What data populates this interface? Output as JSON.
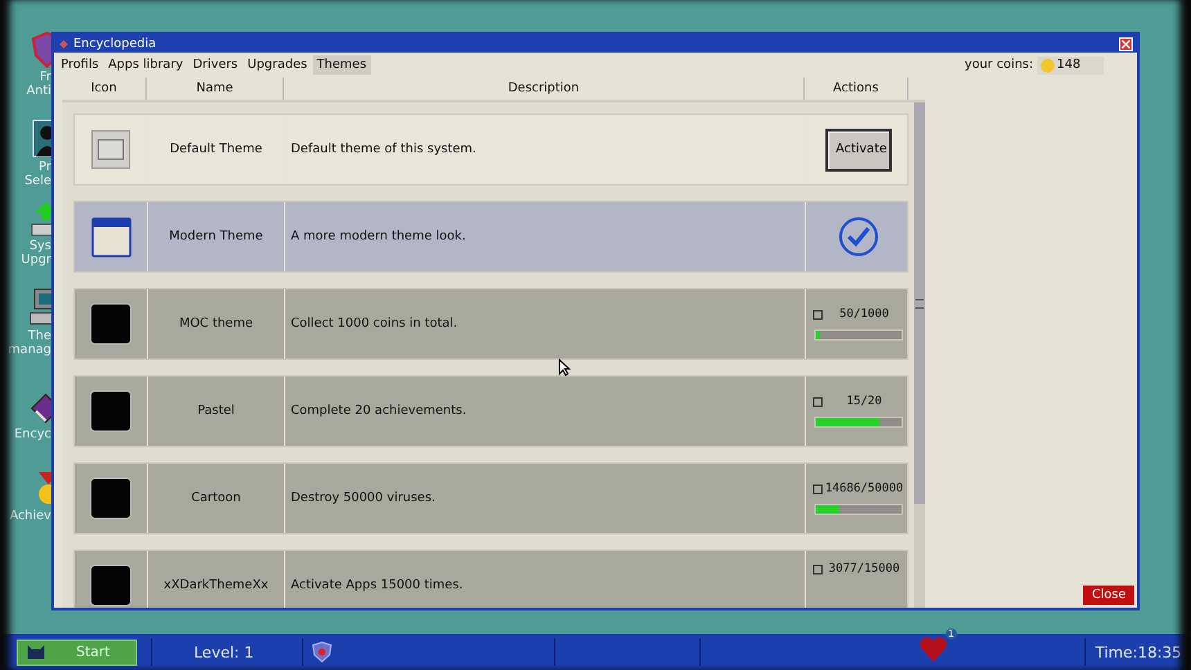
{
  "desktop_icons": [
    {
      "kind": "shield",
      "lines": [
        "Fr",
        "Anti"
      ]
    },
    {
      "kind": "person",
      "lines": [
        "Pr",
        "Sele"
      ]
    },
    {
      "kind": "upgrade",
      "lines": [
        "Sys",
        "Upgr"
      ]
    },
    {
      "kind": "computer",
      "lines": [
        "The",
        "manag"
      ]
    },
    {
      "kind": "book",
      "lines": [
        "Encyc"
      ]
    },
    {
      "kind": "medal",
      "lines": [
        "Achiev"
      ]
    }
  ],
  "window": {
    "title": "Encyclopedia",
    "close_button": "Close"
  },
  "menu": [
    {
      "label": "Profils",
      "selected": false
    },
    {
      "label": "Apps library",
      "selected": false
    },
    {
      "label": "Drivers",
      "selected": false
    },
    {
      "label": "Upgrades",
      "selected": false
    },
    {
      "label": "Themes",
      "selected": true
    }
  ],
  "coins": {
    "label": "your coins:",
    "value": "148"
  },
  "table": {
    "columns": [
      "Icon",
      "Name",
      "Description",
      "Actions"
    ],
    "rows": [
      {
        "kind": "default",
        "name": "Default Theme",
        "description": "Default theme of this system.",
        "action": "Activate",
        "selected": false
      },
      {
        "kind": "modern",
        "name": "Modern Theme",
        "description": "A more modern theme look.",
        "selected": true
      },
      {
        "kind": "locked",
        "name": "MOC theme",
        "description": "Collect 1000 coins in total.",
        "selected": false,
        "checked": false,
        "progress": "50/1000",
        "level": 0.05
      },
      {
        "kind": "locked",
        "name": "Pastel",
        "description": "Complete 20 achievements.",
        "selected": false,
        "checked": false,
        "progress": "15/20",
        "level": 0.75
      },
      {
        "kind": "locked",
        "name": "Cartoon",
        "description": "Destroy 50000 viruses.",
        "selected": false,
        "checked": false,
        "progress": "14686/50000",
        "level": 0.29
      },
      {
        "kind": "locked",
        "name": "xXDarkThemeXx",
        "description": "Activate Apps 15000 times.",
        "selected": false,
        "checked": false,
        "progress": "3077/15000"
      }
    ]
  },
  "taskbar": {
    "start": "Start",
    "level": "Level: 1",
    "notifications": "1",
    "time": "Time:18:35"
  }
}
